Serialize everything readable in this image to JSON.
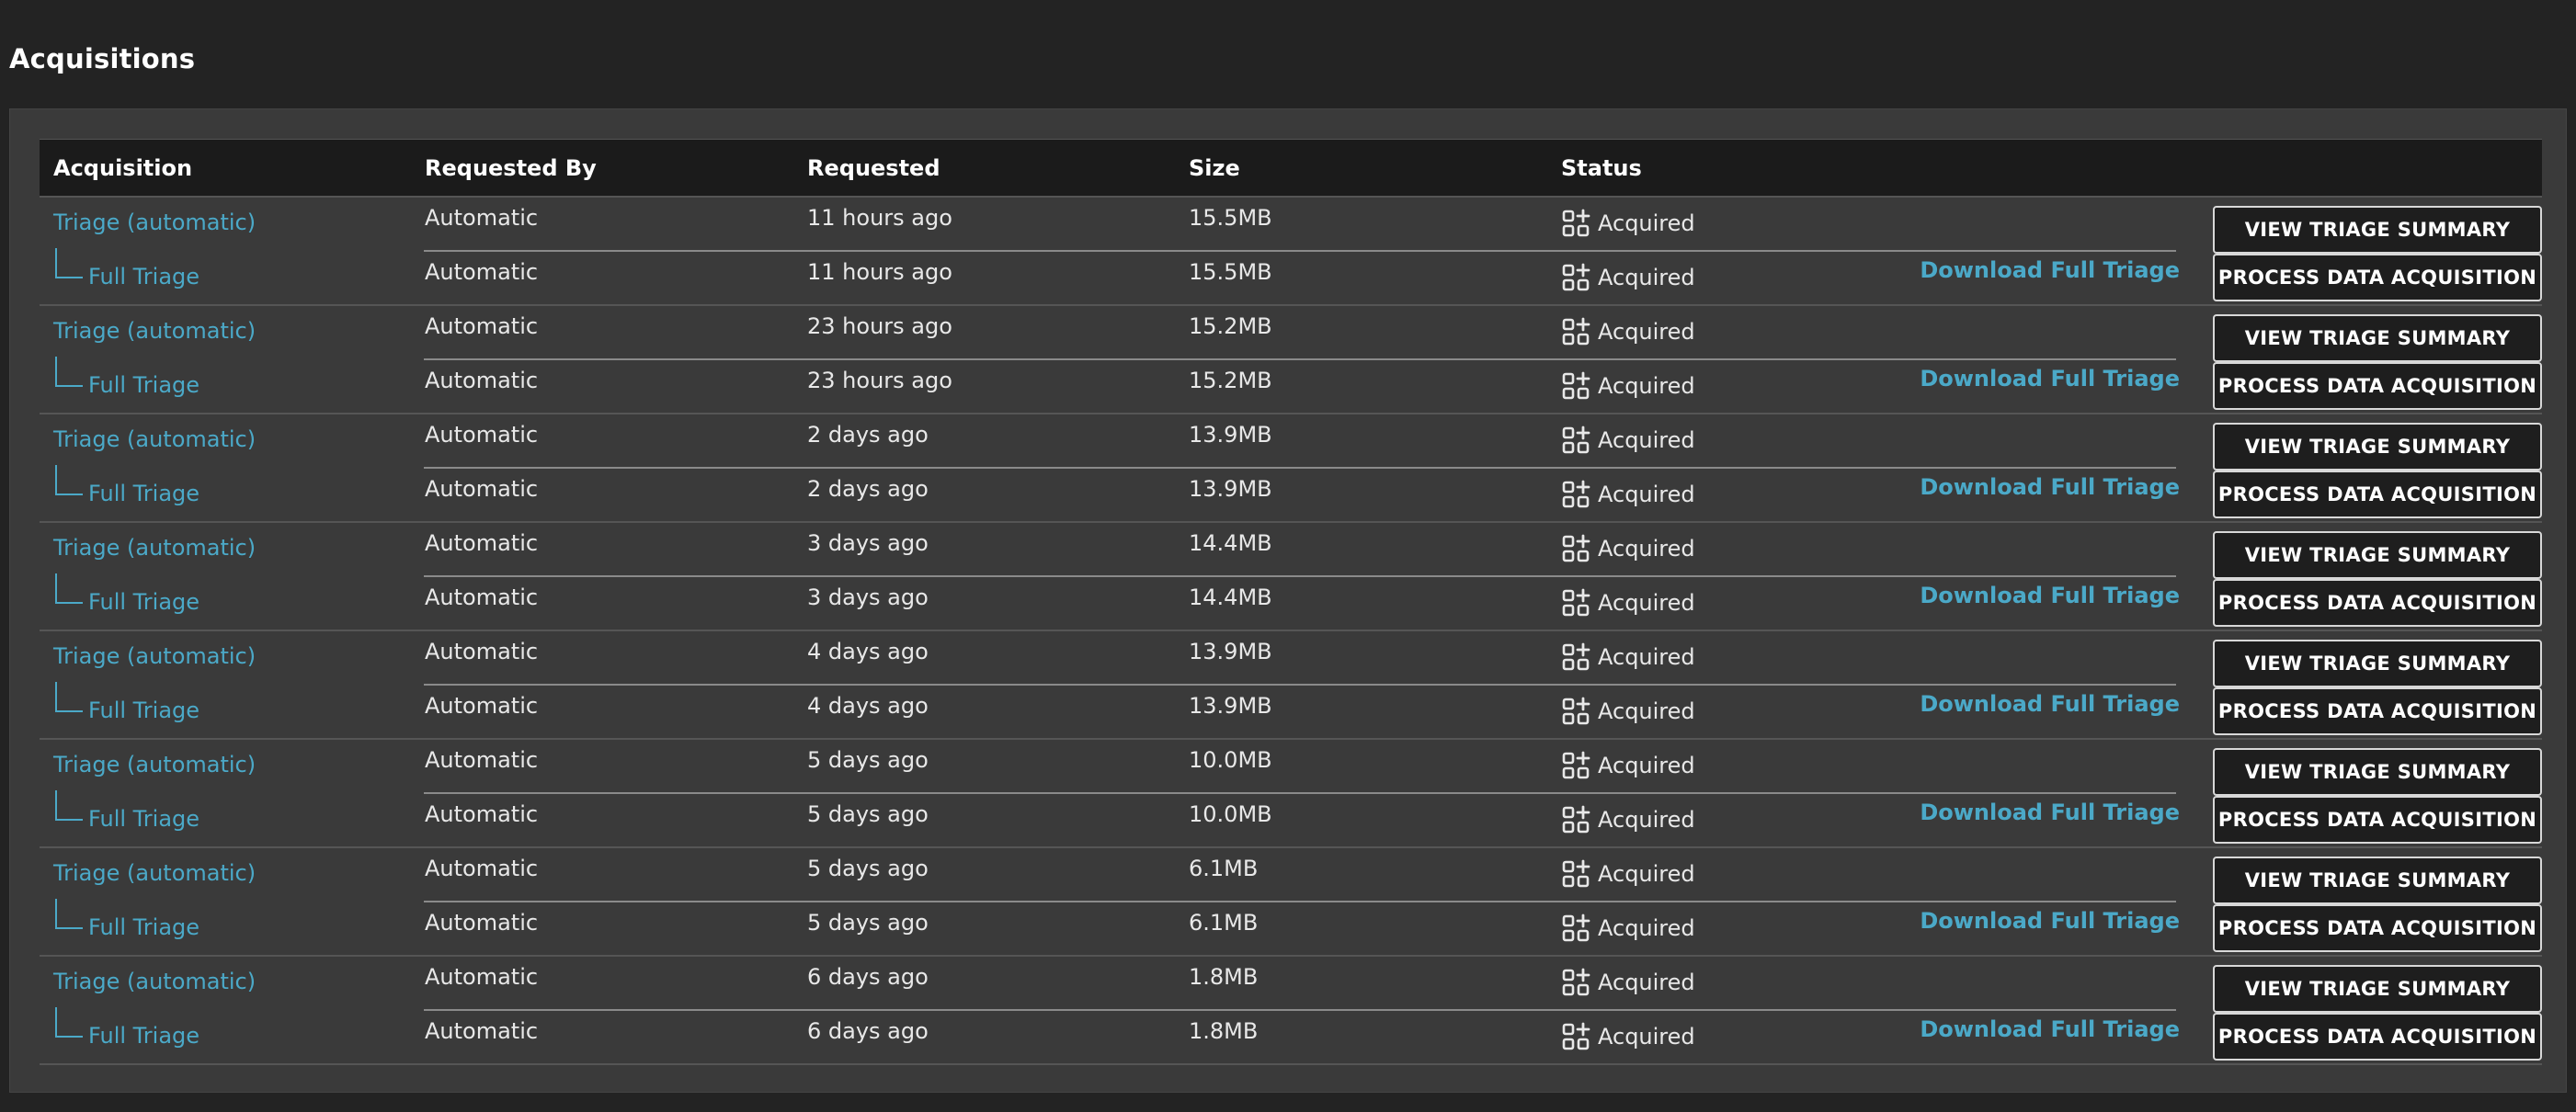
{
  "page": {
    "title": "Acquisitions"
  },
  "table": {
    "headers": {
      "acquisition": "Acquisition",
      "requested_by": "Requested By",
      "requested": "Requested",
      "size": "Size",
      "status": "Status"
    },
    "rows": [
      {
        "parent": {
          "label": "Triage (automatic)",
          "requested_by": "Automatic",
          "requested": "11 hours ago",
          "size": "15.5MB",
          "status": "Acquired",
          "button": "VIEW TRIAGE SUMMARY"
        },
        "child": {
          "label": "Full Triage",
          "requested_by": "Automatic",
          "requested": "11 hours ago",
          "size": "15.5MB",
          "status": "Acquired",
          "download": "Download Full Triage",
          "button": "PROCESS DATA ACQUISITION"
        }
      },
      {
        "parent": {
          "label": "Triage (automatic)",
          "requested_by": "Automatic",
          "requested": "23 hours ago",
          "size": "15.2MB",
          "status": "Acquired",
          "button": "VIEW TRIAGE SUMMARY"
        },
        "child": {
          "label": "Full Triage",
          "requested_by": "Automatic",
          "requested": "23 hours ago",
          "size": "15.2MB",
          "status": "Acquired",
          "download": "Download Full Triage",
          "button": "PROCESS DATA ACQUISITION"
        }
      },
      {
        "parent": {
          "label": "Triage (automatic)",
          "requested_by": "Automatic",
          "requested": "2 days ago",
          "size": "13.9MB",
          "status": "Acquired",
          "button": "VIEW TRIAGE SUMMARY"
        },
        "child": {
          "label": "Full Triage",
          "requested_by": "Automatic",
          "requested": "2 days ago",
          "size": "13.9MB",
          "status": "Acquired",
          "download": "Download Full Triage",
          "button": "PROCESS DATA ACQUISITION"
        }
      },
      {
        "parent": {
          "label": "Triage (automatic)",
          "requested_by": "Automatic",
          "requested": "3 days ago",
          "size": "14.4MB",
          "status": "Acquired",
          "button": "VIEW TRIAGE SUMMARY"
        },
        "child": {
          "label": "Full Triage",
          "requested_by": "Automatic",
          "requested": "3 days ago",
          "size": "14.4MB",
          "status": "Acquired",
          "download": "Download Full Triage",
          "button": "PROCESS DATA ACQUISITION"
        }
      },
      {
        "parent": {
          "label": "Triage (automatic)",
          "requested_by": "Automatic",
          "requested": "4 days ago",
          "size": "13.9MB",
          "status": "Acquired",
          "button": "VIEW TRIAGE SUMMARY"
        },
        "child": {
          "label": "Full Triage",
          "requested_by": "Automatic",
          "requested": "4 days ago",
          "size": "13.9MB",
          "status": "Acquired",
          "download": "Download Full Triage",
          "button": "PROCESS DATA ACQUISITION"
        }
      },
      {
        "parent": {
          "label": "Triage (automatic)",
          "requested_by": "Automatic",
          "requested": "5 days ago",
          "size": "10.0MB",
          "status": "Acquired",
          "button": "VIEW TRIAGE SUMMARY"
        },
        "child": {
          "label": "Full Triage",
          "requested_by": "Automatic",
          "requested": "5 days ago",
          "size": "10.0MB",
          "status": "Acquired",
          "download": "Download Full Triage",
          "button": "PROCESS DATA ACQUISITION"
        }
      },
      {
        "parent": {
          "label": "Triage (automatic)",
          "requested_by": "Automatic",
          "requested": "5 days ago",
          "size": "6.1MB",
          "status": "Acquired",
          "button": "VIEW TRIAGE SUMMARY"
        },
        "child": {
          "label": "Full Triage",
          "requested_by": "Automatic",
          "requested": "5 days ago",
          "size": "6.1MB",
          "status": "Acquired",
          "download": "Download Full Triage",
          "button": "PROCESS DATA ACQUISITION"
        }
      },
      {
        "parent": {
          "label": "Triage (automatic)",
          "requested_by": "Automatic",
          "requested": "6 days ago",
          "size": "1.8MB",
          "status": "Acquired",
          "button": "VIEW TRIAGE SUMMARY"
        },
        "child": {
          "label": "Full Triage",
          "requested_by": "Automatic",
          "requested": "6 days ago",
          "size": "1.8MB",
          "status": "Acquired",
          "download": "Download Full Triage",
          "button": "PROCESS DATA ACQUISITION"
        }
      }
    ]
  },
  "icons": {
    "status": "apps-add-icon"
  },
  "colors": {
    "link": "#4ba9c8",
    "background": "#232323",
    "panel": "#3a3a3a",
    "header": "#1b1b1b"
  }
}
